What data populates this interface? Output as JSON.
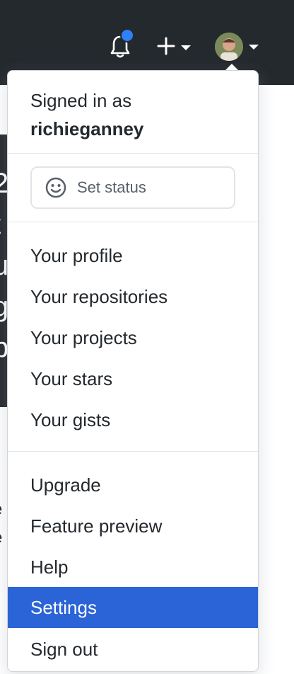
{
  "header": {
    "notification_icon": "bell-icon",
    "create_icon": "plus-icon",
    "avatar_icon": "avatar"
  },
  "menu": {
    "signed_in_label": "Signed in as",
    "username": "richieganney",
    "status_label": "Set status",
    "group1": [
      "Your profile",
      "Your repositories",
      "Your projects",
      "Your stars",
      "Your gists"
    ],
    "group2": [
      "Upgrade",
      "Feature preview",
      "Help",
      "Settings",
      "Sign out"
    ],
    "active_item": "Settings"
  },
  "colors": {
    "header_bg": "#24292e",
    "active_bg": "#2a64d6",
    "notification_dot": "#2f81f7"
  }
}
